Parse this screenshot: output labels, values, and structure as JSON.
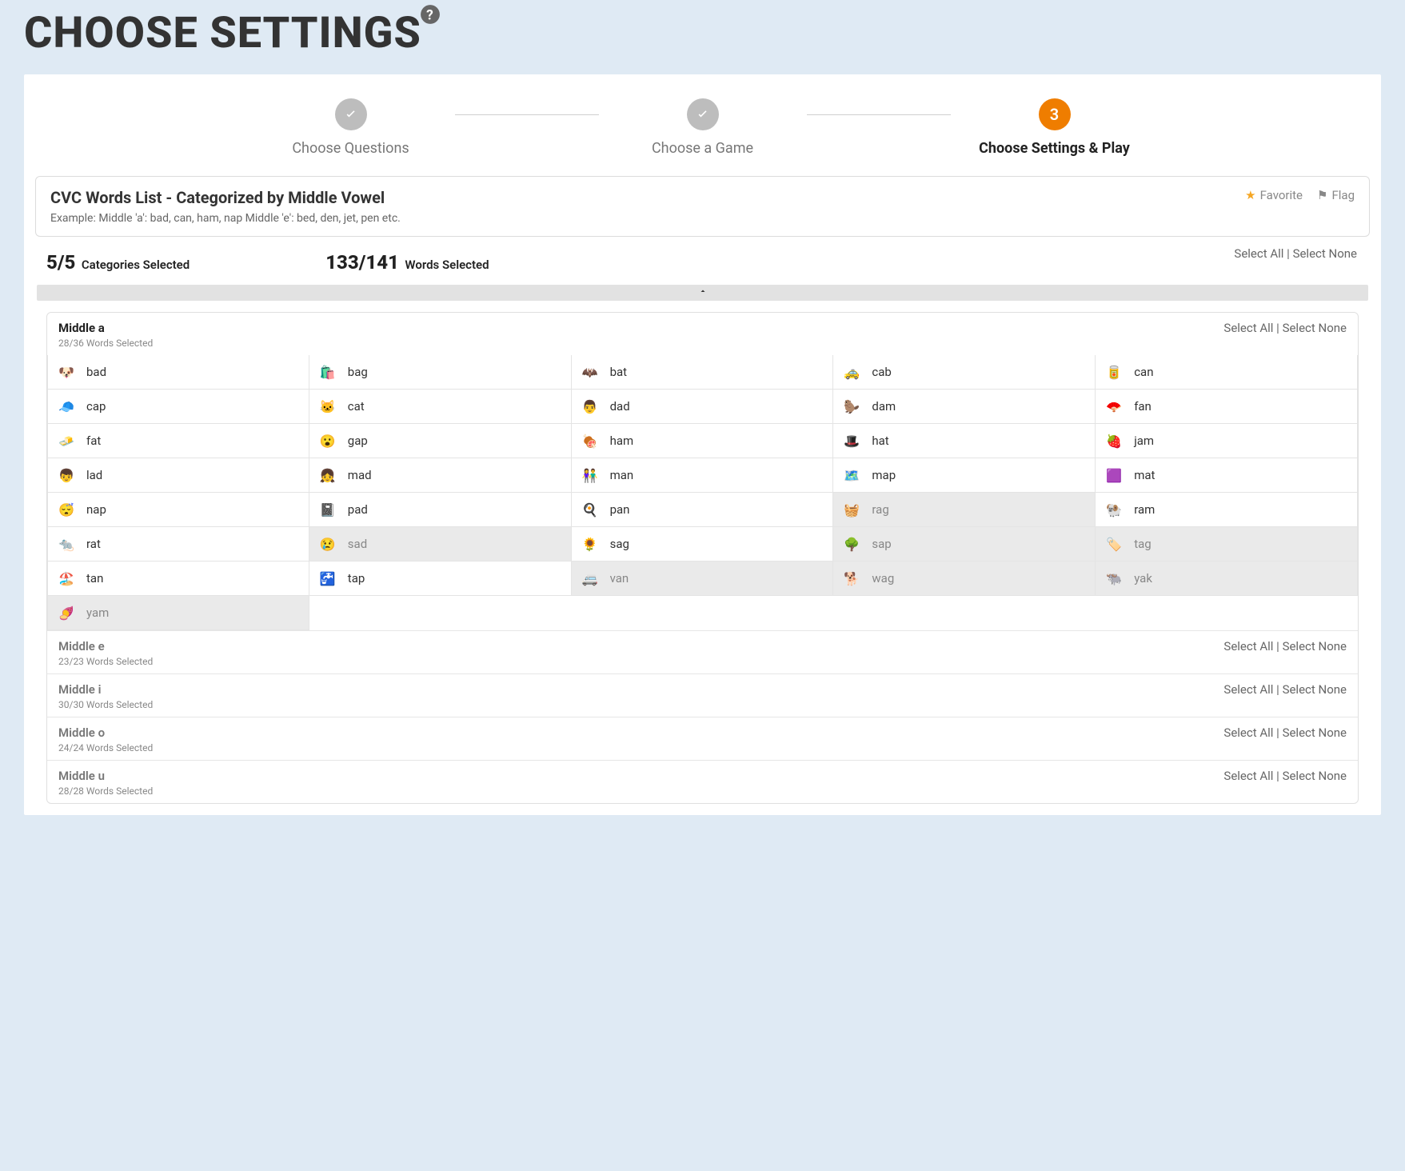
{
  "page_title": "CHOOSE SETTINGS",
  "stepper": {
    "steps": [
      {
        "label": "Choose Questions",
        "done": true
      },
      {
        "label": "Choose a Game",
        "done": true
      },
      {
        "label": "Choose Settings & Play",
        "number": "3",
        "active": true
      }
    ]
  },
  "list": {
    "title": "CVC Words List - Categorized by Middle Vowel",
    "example": "Example: Middle 'a': bad, can, ham, nap Middle 'e': bed, den, jet, pen etc.",
    "favorite_label": "Favorite",
    "flag_label": "Flag"
  },
  "counts": {
    "categories_selected": "5/5",
    "categories_label": "Categories Selected",
    "words_selected": "133/141",
    "words_label": "Words Selected"
  },
  "global": {
    "select_all": "Select All",
    "select_none": "Select None"
  },
  "categories": [
    {
      "name": "Middle a",
      "sub": "28/36 Words Selected",
      "expanded": true,
      "select_all": "Select All",
      "select_none": "Select None",
      "words": [
        {
          "w": "bad",
          "sel": true,
          "emoji": "🐶"
        },
        {
          "w": "bag",
          "sel": true,
          "emoji": "🛍️"
        },
        {
          "w": "bat",
          "sel": true,
          "emoji": "🦇"
        },
        {
          "w": "cab",
          "sel": true,
          "emoji": "🚕"
        },
        {
          "w": "can",
          "sel": true,
          "emoji": "🥫"
        },
        {
          "w": "cap",
          "sel": true,
          "emoji": "🧢"
        },
        {
          "w": "cat",
          "sel": true,
          "emoji": "🐱"
        },
        {
          "w": "dad",
          "sel": true,
          "emoji": "👨"
        },
        {
          "w": "dam",
          "sel": true,
          "emoji": "🦫"
        },
        {
          "w": "fan",
          "sel": true,
          "emoji": "🪭"
        },
        {
          "w": "fat",
          "sel": true,
          "emoji": "🧈"
        },
        {
          "w": "gap",
          "sel": true,
          "emoji": "😮"
        },
        {
          "w": "ham",
          "sel": true,
          "emoji": "🍖"
        },
        {
          "w": "hat",
          "sel": true,
          "emoji": "🎩"
        },
        {
          "w": "jam",
          "sel": true,
          "emoji": "🍓"
        },
        {
          "w": "lad",
          "sel": true,
          "emoji": "👦"
        },
        {
          "w": "mad",
          "sel": true,
          "emoji": "👧"
        },
        {
          "w": "man",
          "sel": true,
          "emoji": "👫"
        },
        {
          "w": "map",
          "sel": true,
          "emoji": "🗺️"
        },
        {
          "w": "mat",
          "sel": true,
          "emoji": "🟪"
        },
        {
          "w": "nap",
          "sel": true,
          "emoji": "😴"
        },
        {
          "w": "pad",
          "sel": true,
          "emoji": "📓"
        },
        {
          "w": "pan",
          "sel": true,
          "emoji": "🍳"
        },
        {
          "w": "rag",
          "sel": false,
          "emoji": "🧺"
        },
        {
          "w": "ram",
          "sel": true,
          "emoji": "🐏"
        },
        {
          "w": "rat",
          "sel": true,
          "emoji": "🐀"
        },
        {
          "w": "sad",
          "sel": false,
          "emoji": "😢"
        },
        {
          "w": "sag",
          "sel": true,
          "emoji": "🌻"
        },
        {
          "w": "sap",
          "sel": false,
          "emoji": "🌳"
        },
        {
          "w": "tag",
          "sel": false,
          "emoji": "🏷️"
        },
        {
          "w": "tan",
          "sel": true,
          "emoji": "🏖️"
        },
        {
          "w": "tap",
          "sel": true,
          "emoji": "🚰"
        },
        {
          "w": "van",
          "sel": false,
          "emoji": "🚐"
        },
        {
          "w": "wag",
          "sel": false,
          "emoji": "🐕"
        },
        {
          "w": "yak",
          "sel": false,
          "emoji": "🐃"
        },
        {
          "w": "yam",
          "sel": false,
          "emoji": "🍠"
        }
      ]
    },
    {
      "name": "Middle e",
      "sub": "23/23 Words Selected",
      "expanded": false,
      "select_all": "Select All",
      "select_none": "Select None"
    },
    {
      "name": "Middle i",
      "sub": "30/30 Words Selected",
      "expanded": false,
      "select_all": "Select All",
      "select_none": "Select None"
    },
    {
      "name": "Middle o",
      "sub": "24/24 Words Selected",
      "expanded": false,
      "select_all": "Select All",
      "select_none": "Select None"
    },
    {
      "name": "Middle u",
      "sub": "28/28 Words Selected",
      "expanded": false,
      "select_all": "Select All",
      "select_none": "Select None"
    }
  ]
}
